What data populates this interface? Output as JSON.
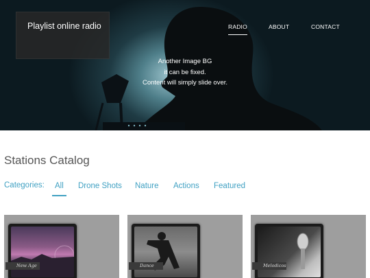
{
  "header": {
    "brand": "Playlist online radio",
    "nav": [
      {
        "label": "RADIO",
        "active": true
      },
      {
        "label": "ABOUT",
        "active": false
      },
      {
        "label": "CONTACT",
        "active": false
      }
    ],
    "hero_lines": [
      "Another Image BG",
      "it can be fixed.",
      "Content will simply slide over."
    ]
  },
  "catalog": {
    "title": "Stations Catalog",
    "categories_label": "Categories:",
    "categories": [
      "All",
      "Drone Shots",
      "Nature",
      "Actions",
      "Featured"
    ],
    "active_category": "All",
    "cards": [
      {
        "tag": "New Age"
      },
      {
        "tag": "Dance"
      },
      {
        "tag": "Melodicos"
      }
    ]
  }
}
